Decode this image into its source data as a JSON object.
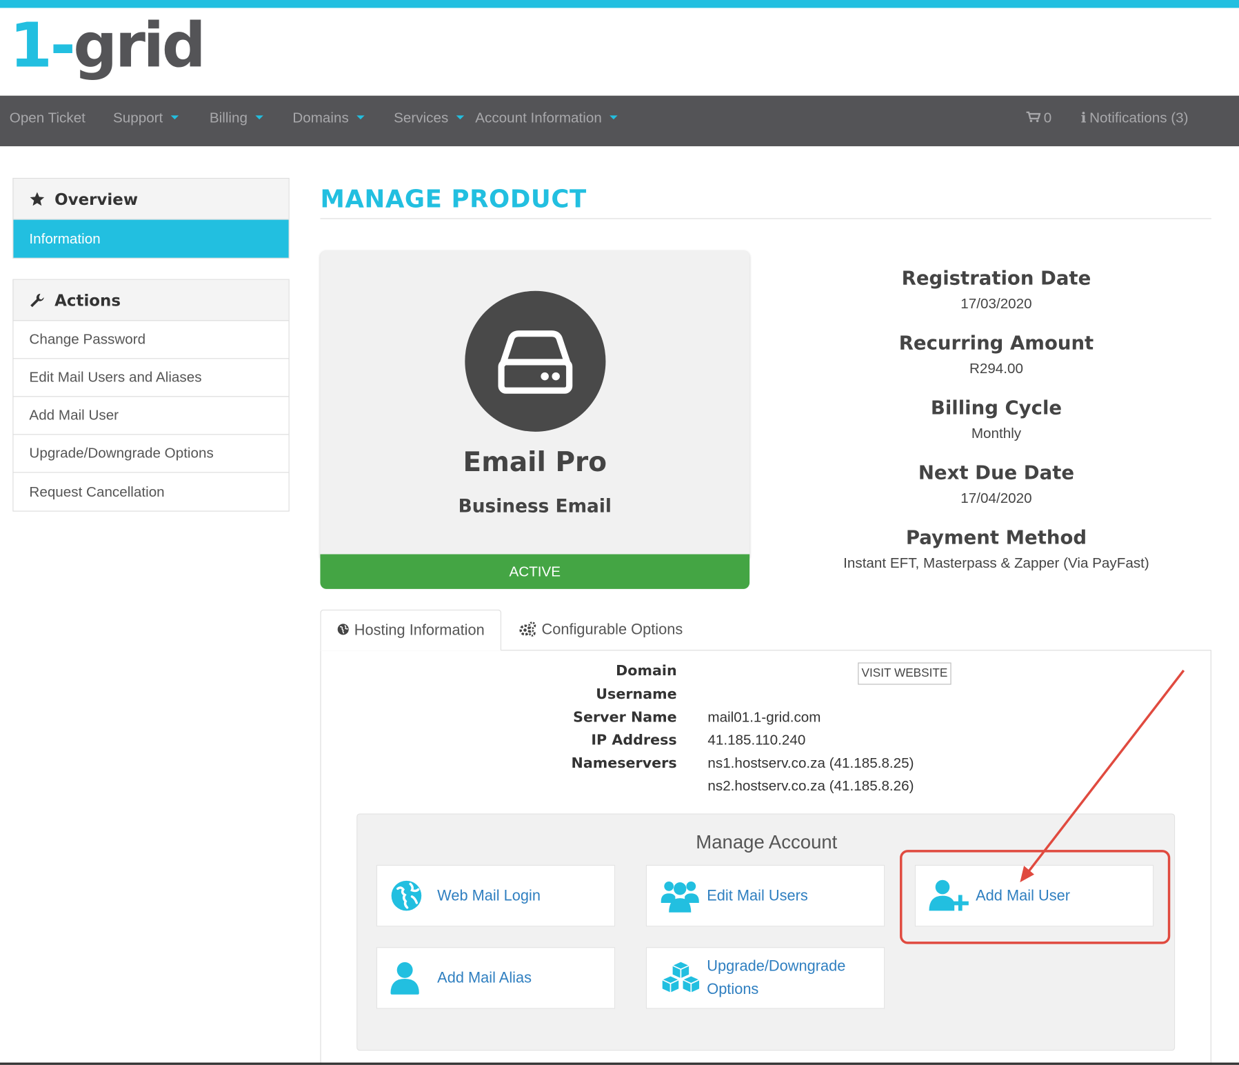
{
  "brand": {
    "logo_one": "1",
    "logo_dash": "-",
    "logo_grid": "grid",
    "accent": "#22bfe0",
    "dark": "#545457"
  },
  "nav": {
    "open_ticket": "Open Ticket",
    "support": "Support",
    "billing": "Billing",
    "domains": "Domains",
    "services": "Services",
    "account_information": "Account Information",
    "cart_count": "0",
    "notifications": "Notifications (3)"
  },
  "sidebar": {
    "overview": {
      "title": "Overview",
      "active_item": "Information"
    },
    "actions": {
      "title": "Actions",
      "items": [
        {
          "label": "Change Password"
        },
        {
          "label": "Edit Mail Users and Aliases"
        },
        {
          "label": "Add Mail User"
        },
        {
          "label": "Upgrade/Downgrade Options"
        },
        {
          "label": "Request Cancellation"
        }
      ]
    }
  },
  "page": {
    "title": "MANAGE PRODUCT"
  },
  "product": {
    "name": "Email Pro",
    "group": "Business Email",
    "status": "ACTIVE",
    "status_color": "#44a544"
  },
  "details": {
    "registration_date_label": "Registration Date",
    "registration_date": "17/03/2020",
    "recurring_amount_label": "Recurring Amount",
    "recurring_amount": "R294.00",
    "billing_cycle_label": "Billing Cycle",
    "billing_cycle": "Monthly",
    "next_due_date_label": "Next Due Date",
    "next_due_date": "17/04/2020",
    "payment_method_label": "Payment Method",
    "payment_method": "Instant EFT, Masterpass & Zapper (Via PayFast)"
  },
  "tabs": {
    "hosting": "Hosting Information",
    "configurable": "Configurable Options"
  },
  "hosting": {
    "domain_label": "Domain",
    "username_label": "Username",
    "server_name_label": "Server Name",
    "server_name": "mail01.1-grid.com",
    "ip_address_label": "IP Address",
    "ip_address": "41.185.110.240",
    "nameservers_label": "Nameservers",
    "nameserver_1": "ns1.hostserv.co.za (41.185.8.25)",
    "nameserver_2": "ns2.hostserv.co.za (41.185.8.26)",
    "visit_website": "VISIT WEBSITE"
  },
  "manage": {
    "title": "Manage Account",
    "tiles": [
      {
        "label": "Web Mail Login",
        "icon": "globe-icon"
      },
      {
        "label": "Edit Mail Users",
        "icon": "users-icon"
      },
      {
        "label": "Add Mail User",
        "icon": "user-plus-icon"
      },
      {
        "label": "Add Mail Alias",
        "icon": "user-icon"
      },
      {
        "label_line1": "Upgrade/Downgrade",
        "label_line2": "Options",
        "icon": "cubes-icon"
      }
    ]
  },
  "annotation": {
    "color": "#e04a3f"
  }
}
